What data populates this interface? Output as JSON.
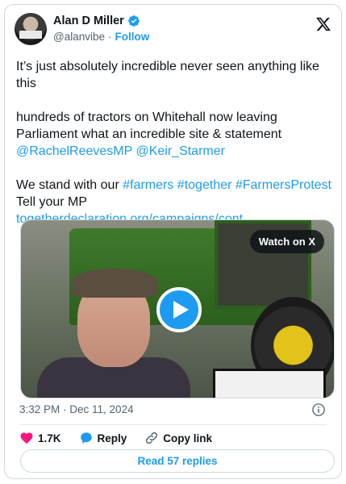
{
  "author": {
    "display_name": "Alan D Miller",
    "handle": "@alanvibe",
    "separator": "·",
    "follow_label": "Follow",
    "verified_color": "#1d9bf0"
  },
  "tweet": {
    "line1": "It’s just absolutely incredible never seen anything like this",
    "line2": "hundreds of tractors on Whitehall now leaving Parliament what an incredible site & statement",
    "mention1": "@RachelReevesMP",
    "mention2": "@Keir_Starmer",
    "line3_prefix": "We stand with our ",
    "hashtag1": "#farmers",
    "hashtag2": "#together",
    "hashtag3": "#FarmersProtest",
    "line4": "Tell your MP",
    "link": "togetherdeclaration.org/campaigns/cont..."
  },
  "media": {
    "watch_label": "Watch on X",
    "icon": "play-icon"
  },
  "meta": {
    "timestamp": "3:32 PM · Dec 11, 2024",
    "info_icon": "info-icon"
  },
  "actions": {
    "likes": "1.7K",
    "reply_label": "Reply",
    "copy_link_label": "Copy link"
  },
  "footer": {
    "read_replies_label": "Read 57 replies"
  },
  "colors": {
    "accent": "#1d9bf0",
    "like": "#f91880",
    "text": "#0f1419",
    "muted": "#536471"
  }
}
